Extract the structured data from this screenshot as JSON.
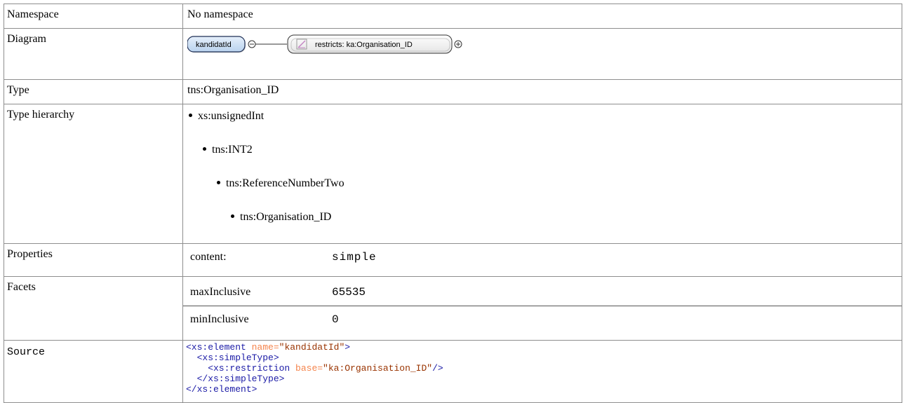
{
  "rows": {
    "namespace": {
      "label": "Namespace",
      "value": "No namespace"
    },
    "diagram": {
      "label": "Diagram",
      "element_name": "kandidatId",
      "restriction_text": "restricts: ka:Organisation_ID"
    },
    "type": {
      "label": "Type",
      "value": "tns:Organisation_ID"
    },
    "type_hierarchy": {
      "label": "Type hierarchy",
      "items": [
        "xs:unsignedInt",
        "tns:INT2",
        "tns:ReferenceNumberTwo",
        "tns:Organisation_ID"
      ]
    },
    "properties": {
      "label": "Properties",
      "key": "content:",
      "value": "simple"
    },
    "facets": {
      "label": "Facets",
      "items": [
        {
          "key": "maxInclusive",
          "value": "65535"
        },
        {
          "key": "minInclusive",
          "value": "0"
        }
      ]
    },
    "source": {
      "label": "Source",
      "line1": {
        "open": "<xs:element",
        "attr": " name=",
        "val": "\"kandidatId\"",
        "close": ">"
      },
      "line2": "  <xs:simpleType>",
      "line3": {
        "open": "    <xs:restriction",
        "attr": " base=",
        "val": "\"ka:Organisation_ID\"",
        "close": "/>"
      },
      "line4": "  </xs:simpleType>",
      "line5": "</xs:element>"
    }
  },
  "colors": {
    "border": "#8e8e8e",
    "tag": "#1a1aa6",
    "attr": "#f5844c",
    "value": "#993300",
    "diagram_fill": "#cfe0f4",
    "diagram_stroke": "#444444",
    "restrict_icon": "#c486c4"
  },
  "icons": {
    "collapse": "minus-circle-icon",
    "expand": "plus-circle-icon",
    "restriction": "restriction-triangle-icon"
  }
}
